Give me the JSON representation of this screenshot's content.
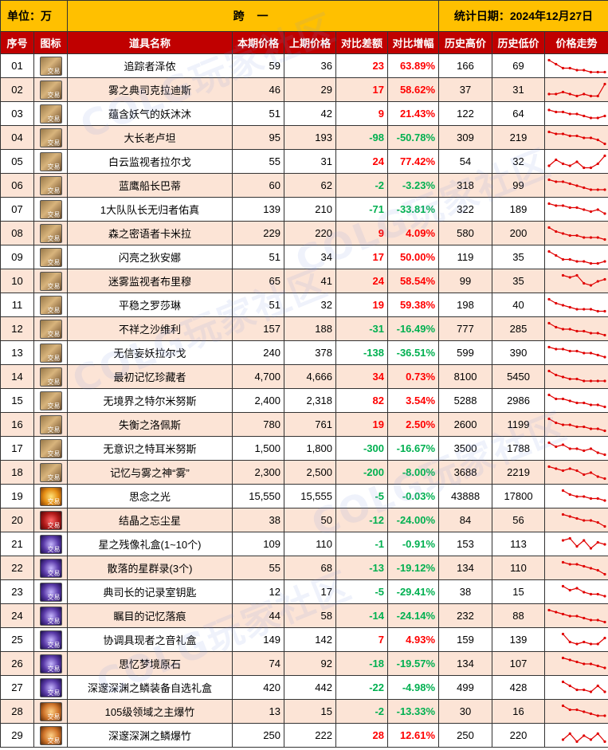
{
  "header": {
    "unit": "单位：万",
    "title": "跨 一",
    "date": "统计日期：2024年12月27日"
  },
  "columns": [
    "序号",
    "图标",
    "道具名称",
    "本期价格",
    "上期价格",
    "对比差额",
    "对比增幅",
    "历史高价",
    "历史低价",
    "价格走势"
  ],
  "icon_tag": "交易",
  "watermark": "COLG玩家社区",
  "colors": {
    "header_bg": "#FFC000",
    "column_header_bg": "#C00000",
    "stripe": "#FCE4D6",
    "up": "#FF0000",
    "down": "#00B050",
    "trend": "#E00000"
  },
  "rows": [
    {
      "no": "01",
      "icon": "card-icon",
      "name": "追踪者泽侬",
      "cur": "59",
      "prev": "36",
      "diff": "23",
      "pct": "63.89%",
      "high": "166",
      "low": "69",
      "trend": [
        8,
        6,
        4,
        4,
        3,
        3,
        2,
        2,
        2
      ]
    },
    {
      "no": "02",
      "icon": "card-icon",
      "name": "雾之典司克拉迪斯",
      "cur": "46",
      "prev": "29",
      "diff": "17",
      "pct": "58.62%",
      "high": "37",
      "low": "31",
      "trend": [
        3,
        3,
        4,
        3,
        2,
        3,
        2,
        2,
        8
      ]
    },
    {
      "no": "03",
      "icon": "card-icon",
      "name": "蕴含妖气的妖沐沐",
      "cur": "51",
      "prev": "42",
      "diff": "9",
      "pct": "21.43%",
      "high": "122",
      "low": "64",
      "trend": [
        7,
        6,
        6,
        5,
        5,
        4,
        3,
        3,
        4
      ]
    },
    {
      "no": "04",
      "icon": "card-icon",
      "name": "大长老卢坦",
      "cur": "95",
      "prev": "193",
      "diff": "-98",
      "pct": "-50.78%",
      "high": "309",
      "low": "219",
      "trend": [
        8,
        7,
        7,
        6,
        6,
        5,
        5,
        4,
        2
      ]
    },
    {
      "no": "05",
      "icon": "card-icon",
      "name": "白云监视者拉尔戈",
      "cur": "55",
      "prev": "31",
      "diff": "24",
      "pct": "77.42%",
      "high": "54",
      "low": "32",
      "trend": [
        3,
        6,
        4,
        3,
        5,
        2,
        2,
        4,
        8
      ]
    },
    {
      "no": "06",
      "icon": "card-icon",
      "name": "蓝鹰船长巴蒂",
      "cur": "60",
      "prev": "62",
      "diff": "-2",
      "pct": "-3.23%",
      "high": "318",
      "low": "99",
      "trend": [
        8,
        7,
        7,
        6,
        5,
        4,
        3,
        3,
        3
      ]
    },
    {
      "no": "07",
      "icon": "card-icon",
      "name": "1大队队长无归者佑真",
      "cur": "139",
      "prev": "210",
      "diff": "-71",
      "pct": "-33.81%",
      "high": "322",
      "low": "189",
      "trend": [
        8,
        7,
        7,
        6,
        6,
        5,
        4,
        5,
        3
      ]
    },
    {
      "no": "08",
      "icon": "card-icon",
      "name": "森之密语者卡米拉",
      "cur": "229",
      "prev": "220",
      "diff": "9",
      "pct": "4.09%",
      "high": "580",
      "low": "200",
      "trend": [
        8,
        6,
        5,
        4,
        4,
        3,
        3,
        3,
        2
      ]
    },
    {
      "no": "09",
      "icon": "card-icon",
      "name": "闪亮之狄安娜",
      "cur": "51",
      "prev": "34",
      "diff": "17",
      "pct": "50.00%",
      "high": "119",
      "low": "35",
      "trend": [
        8,
        6,
        4,
        4,
        3,
        3,
        2,
        2,
        3
      ]
    },
    {
      "no": "10",
      "icon": "card-icon",
      "name": "迷雾监视者布里穆",
      "cur": "65",
      "prev": "41",
      "diff": "24",
      "pct": "58.54%",
      "high": "99",
      "low": "35",
      "trend": [
        null,
        null,
        8,
        7,
        8,
        4,
        3,
        5,
        6
      ]
    },
    {
      "no": "11",
      "icon": "card-icon",
      "name": "平稳之罗莎琳",
      "cur": "51",
      "prev": "32",
      "diff": "19",
      "pct": "59.38%",
      "high": "198",
      "low": "40",
      "trend": [
        8,
        6,
        5,
        4,
        3,
        3,
        3,
        2,
        2
      ]
    },
    {
      "no": "12",
      "icon": "card-icon",
      "name": "不祥之沙维利",
      "cur": "157",
      "prev": "188",
      "diff": "-31",
      "pct": "-16.49%",
      "high": "777",
      "low": "285",
      "trend": [
        8,
        6,
        5,
        5,
        4,
        4,
        3,
        3,
        2
      ]
    },
    {
      "no": "13",
      "icon": "card-icon",
      "name": "无信妄妖拉尔戈",
      "cur": "240",
      "prev": "378",
      "diff": "-138",
      "pct": "-36.51%",
      "high": "599",
      "low": "390",
      "trend": [
        8,
        7,
        7,
        6,
        6,
        5,
        5,
        4,
        3
      ]
    },
    {
      "no": "14",
      "icon": "card-icon",
      "name": "最初记忆珍藏者",
      "cur": "4,700",
      "prev": "4,666",
      "diff": "34",
      "pct": "0.73%",
      "high": "8100",
      "low": "5450",
      "trend": [
        8,
        6,
        5,
        4,
        4,
        3,
        3,
        3,
        3
      ]
    },
    {
      "no": "15",
      "icon": "card-icon",
      "name": "无境界之特尔米努斯",
      "cur": "2,400",
      "prev": "2,318",
      "diff": "82",
      "pct": "3.54%",
      "high": "5288",
      "low": "2986",
      "trend": [
        8,
        6,
        6,
        5,
        4,
        4,
        3,
        3,
        2
      ]
    },
    {
      "no": "16",
      "icon": "card-icon",
      "name": "失衡之洛佩斯",
      "cur": "780",
      "prev": "761",
      "diff": "19",
      "pct": "2.50%",
      "high": "2600",
      "low": "1199",
      "trend": [
        8,
        6,
        5,
        5,
        4,
        4,
        3,
        3,
        2
      ]
    },
    {
      "no": "17",
      "icon": "card-icon",
      "name": "无意识之特耳米努斯",
      "cur": "1,500",
      "prev": "1,800",
      "diff": "-300",
      "pct": "-16.67%",
      "high": "3500",
      "low": "1788",
      "trend": [
        8,
        6,
        7,
        5,
        5,
        4,
        5,
        3,
        2
      ]
    },
    {
      "no": "18",
      "icon": "card-icon",
      "name": "记忆与雾之神“雾”",
      "cur": "2,300",
      "prev": "2,500",
      "diff": "-200",
      "pct": "-8.00%",
      "high": "3688",
      "low": "2219",
      "trend": [
        8,
        7,
        6,
        7,
        6,
        4,
        5,
        3,
        2
      ]
    },
    {
      "no": "19",
      "icon": "orb-icon",
      "name": "思念之光",
      "cur": "15,550",
      "prev": "15,555",
      "diff": "-5",
      "pct": "-0.03%",
      "high": "43888",
      "low": "17800",
      "trend": [
        null,
        null,
        8,
        6,
        5,
        5,
        4,
        4,
        3
      ]
    },
    {
      "no": "20",
      "icon": "crystal-icon",
      "name": "结晶之忘尘星",
      "cur": "38",
      "prev": "50",
      "diff": "-12",
      "pct": "-24.00%",
      "high": "84",
      "low": "56",
      "trend": [
        null,
        null,
        8,
        7,
        6,
        5,
        5,
        4,
        2
      ]
    },
    {
      "no": "21",
      "icon": "box-icon",
      "name": "星之残像礼盒(1~10个)",
      "cur": "109",
      "prev": "110",
      "diff": "-1",
      "pct": "-0.91%",
      "high": "153",
      "low": "113",
      "trend": [
        null,
        null,
        7,
        8,
        4,
        7,
        3,
        6,
        5
      ]
    },
    {
      "no": "22",
      "icon": "book-icon",
      "name": "散落的星群录(3个)",
      "cur": "55",
      "prev": "68",
      "diff": "-13",
      "pct": "-19.12%",
      "high": "134",
      "low": "110",
      "trend": [
        null,
        null,
        8,
        7,
        7,
        6,
        5,
        4,
        2
      ]
    },
    {
      "no": "23",
      "icon": "key-icon",
      "name": "典司长的记录室钥匙",
      "cur": "12",
      "prev": "17",
      "diff": "-5",
      "pct": "-29.41%",
      "high": "38",
      "low": "15",
      "trend": [
        null,
        null,
        8,
        6,
        7,
        5,
        4,
        4,
        3
      ]
    },
    {
      "no": "24",
      "icon": "gem-icon",
      "name": "瞩目的记忆落痕",
      "cur": "44",
      "prev": "58",
      "diff": "-14",
      "pct": "-24.14%",
      "high": "232",
      "low": "88",
      "trend": [
        8,
        7,
        6,
        5,
        5,
        4,
        3,
        3,
        2
      ]
    },
    {
      "no": "25",
      "icon": "box-icon",
      "name": "协调具现者之音礼盒",
      "cur": "149",
      "prev": "142",
      "diff": "7",
      "pct": "4.93%",
      "high": "159",
      "low": "139",
      "trend": [
        null,
        null,
        8,
        4,
        3,
        4,
        3,
        3,
        6
      ]
    },
    {
      "no": "26",
      "icon": "stone-icon",
      "name": "思忆梦境原石",
      "cur": "74",
      "prev": "92",
      "diff": "-18",
      "pct": "-19.57%",
      "high": "134",
      "low": "107",
      "trend": [
        null,
        null,
        8,
        7,
        6,
        5,
        5,
        4,
        3
      ]
    },
    {
      "no": "27",
      "icon": "box-icon",
      "name": "深邃深渊之鳞装备自选礼盒",
      "cur": "420",
      "prev": "442",
      "diff": "-22",
      "pct": "-4.98%",
      "high": "499",
      "low": "428",
      "trend": [
        null,
        null,
        8,
        6,
        4,
        4,
        3,
        6,
        3
      ]
    },
    {
      "no": "28",
      "icon": "firecracker-icon",
      "name": "105级领域之主爆竹",
      "cur": "13",
      "prev": "15",
      "diff": "-2",
      "pct": "-13.33%",
      "high": "30",
      "low": "16",
      "trend": [
        null,
        null,
        8,
        6,
        6,
        5,
        4,
        3,
        3
      ]
    },
    {
      "no": "29",
      "icon": "firecracker-icon",
      "name": "深邃深渊之鳞爆竹",
      "cur": "250",
      "prev": "222",
      "diff": "28",
      "pct": "12.61%",
      "high": "250",
      "low": "220",
      "trend": [
        null,
        null,
        3,
        6,
        2,
        5,
        3,
        6,
        2
      ]
    }
  ]
}
